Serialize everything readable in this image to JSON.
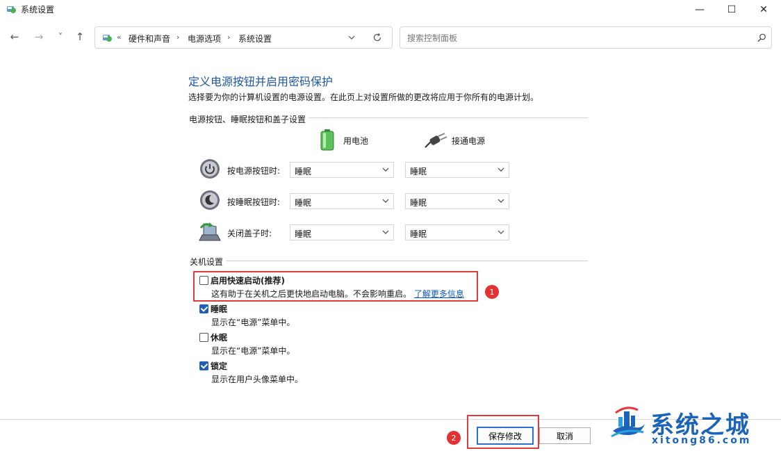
{
  "window": {
    "title": "系统设置",
    "icon": "control-panel-icon"
  },
  "window_controls": {
    "minimize": "—",
    "maximize": "☐",
    "close": "✕"
  },
  "nav": {
    "back": "←",
    "forward": "→",
    "recent": "˅",
    "up": "↑"
  },
  "address": {
    "root_sep": "«",
    "crumbs": [
      "硬件和声音",
      "电源选项",
      "系统设置"
    ],
    "crumb_sep": "›"
  },
  "search": {
    "placeholder": "搜索控制面板"
  },
  "page": {
    "title": "定义电源按钮并启用密码保护",
    "description": "选择要为你的计算机设置的电源设置。在此页上对设置所做的更改将应用于你所有的电源计划。"
  },
  "power_buttons": {
    "group_label": "电源按钮、睡眠按钮和盖子设置",
    "battery_label": "用电池",
    "plugged_label": "接通电源",
    "rows": [
      {
        "label": "按电源按钮时:",
        "battery": "睡眠",
        "plugged": "睡眠",
        "icon": "power-button-icon"
      },
      {
        "label": "按睡眠按钮时:",
        "battery": "睡眠",
        "plugged": "睡眠",
        "icon": "sleep-button-icon"
      },
      {
        "label": "关闭盖子时:",
        "battery": "睡眠",
        "plugged": "睡眠",
        "icon": "laptop-lid-icon"
      }
    ]
  },
  "shutdown": {
    "group_label": "关机设置",
    "options": [
      {
        "title": "启用快速启动(推荐)",
        "desc": "这有助于在关机之后更快地启动电脑。不会影响重启。",
        "link": "了解更多信息",
        "checked": false
      },
      {
        "title": "睡眠",
        "desc": "显示在“电源”菜单中。",
        "checked": true
      },
      {
        "title": "休眠",
        "desc": "显示在“电源”菜单中。",
        "checked": false
      },
      {
        "title": "锁定",
        "desc": "显示在用户头像菜单中。",
        "checked": true
      }
    ]
  },
  "annotations": {
    "badge1": "1",
    "badge2": "2",
    "highlight_color": "#e03a3a"
  },
  "buttons": {
    "save": "保存修改",
    "cancel": "取消"
  },
  "watermark": {
    "title": "系统之城",
    "url": "xitong86.com"
  },
  "colors": {
    "heading": "#1e56a0",
    "link": "#0a58c9",
    "checkbox": "#1f5fb8",
    "watermark": "#1b64b8"
  }
}
